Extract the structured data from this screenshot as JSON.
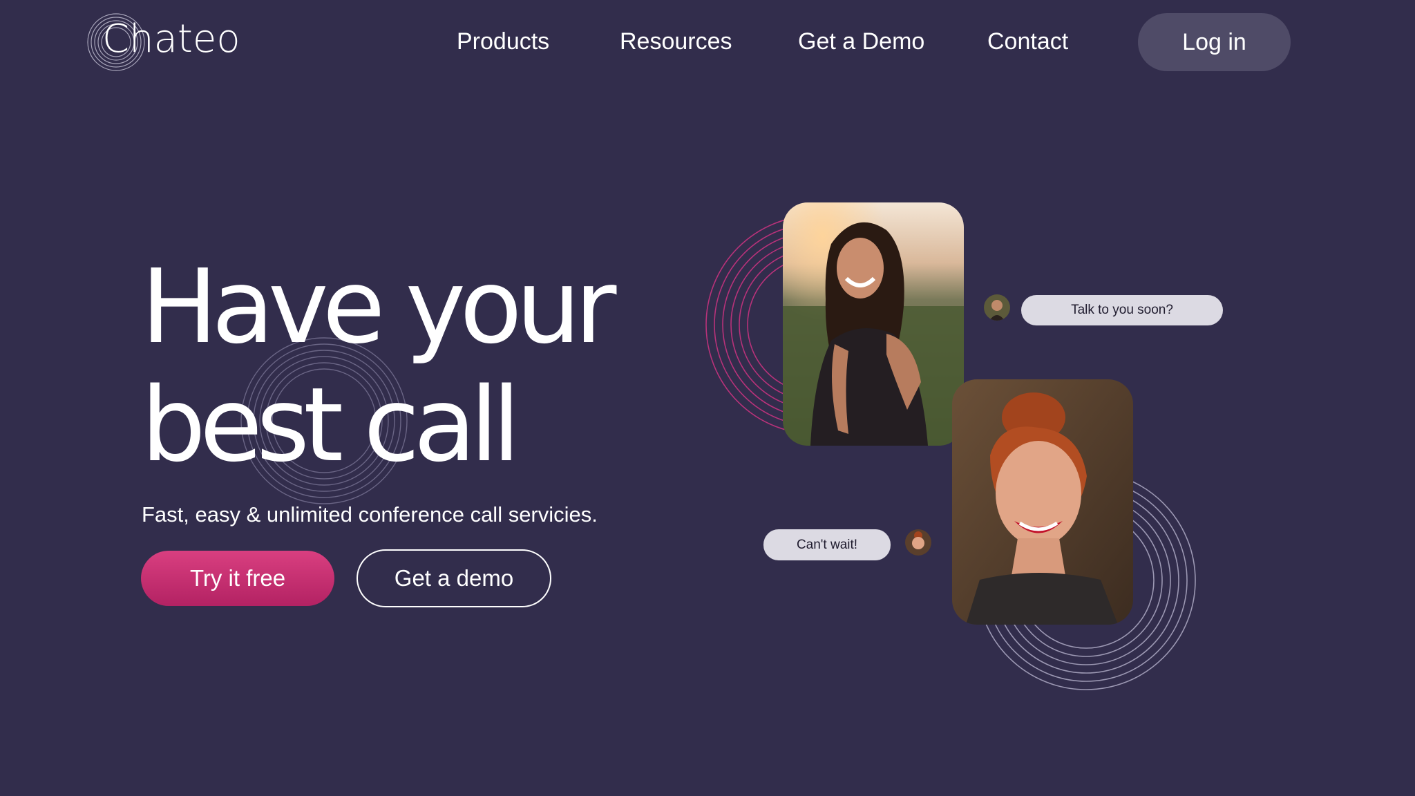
{
  "header": {
    "logo_text": "Chateo",
    "nav": {
      "products": "Products",
      "resources": "Resources",
      "get_demo": "Get a Demo",
      "contact": "Contact"
    },
    "login_label": "Log in"
  },
  "hero": {
    "title_line1": "Have your",
    "title_line2": "best call",
    "subtitle": "Fast, easy & unlimited conference call servicies.",
    "primary_cta": "Try it free",
    "secondary_cta": "Get a demo"
  },
  "illustration": {
    "bubble_1": "Talk to you soon?",
    "bubble_2": "Can't wait!"
  },
  "colors": {
    "background": "#322d4c",
    "accent": "#c92b6f",
    "login_button": "#4f4b67",
    "bubble": "#dcdae3"
  }
}
